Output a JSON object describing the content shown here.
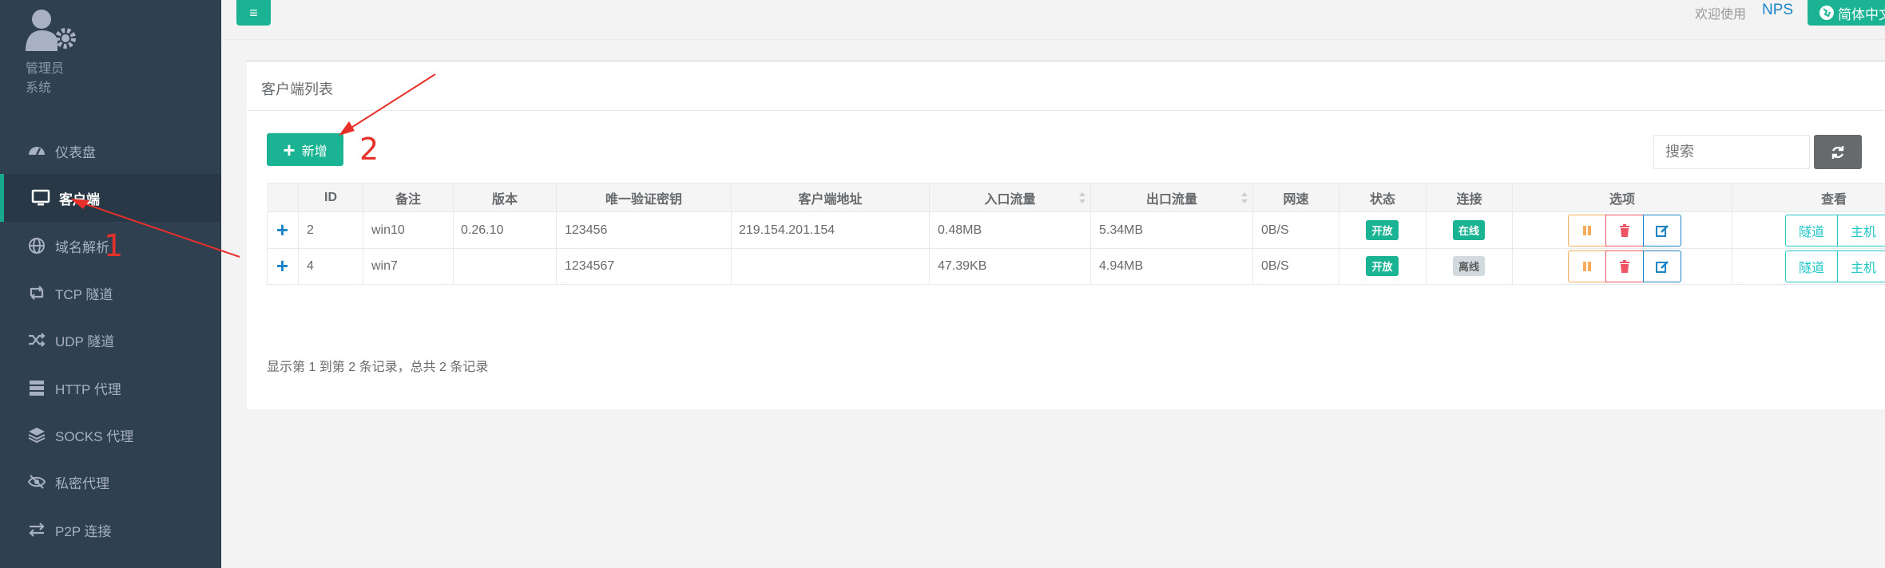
{
  "profile": {
    "name": "管理员",
    "role": "系统"
  },
  "sidebar": {
    "items": [
      {
        "label": "仪表盘",
        "icon": "dashboard-icon"
      },
      {
        "label": "客户端",
        "icon": "monitor-icon"
      },
      {
        "label": "域名解析",
        "icon": "globe-icon"
      },
      {
        "label": "TCP 隧道",
        "icon": "retweet-icon"
      },
      {
        "label": "UDP 隧道",
        "icon": "random-icon"
      },
      {
        "label": "HTTP 代理",
        "icon": "server-icon"
      },
      {
        "label": "SOCKS 代理",
        "icon": "layers-icon"
      },
      {
        "label": "私密代理",
        "icon": "eye-slash-icon"
      },
      {
        "label": "P2P 连接",
        "icon": "exchange-icon"
      }
    ]
  },
  "topbar": {
    "menu_icon": "≡",
    "welcome": "欢迎使用",
    "brand": "NPS",
    "language": "简体中文"
  },
  "panel": {
    "title": "客户端列表",
    "add_label": "新增",
    "search_placeholder": "搜索",
    "footer": "显示第 1 到第 2 条记录，总共 2 条记录"
  },
  "table": {
    "headers": [
      "",
      "ID",
      "备注",
      "版本",
      "唯一验证密钥",
      "客户端地址",
      "入口流量",
      "出口流量",
      "网速",
      "状态",
      "连接",
      "选项",
      "查看"
    ],
    "rows": [
      {
        "id": "2",
        "remark": "win10",
        "version": "0.26.10",
        "vkey": "123456",
        "addr": "219.154.201.154",
        "in_flow": "0.48MB",
        "out_flow": "5.34MB",
        "rate": "0B/S",
        "status": "开放",
        "conn": "在线",
        "conn_online": true
      },
      {
        "id": "4",
        "remark": "win7",
        "version": "",
        "vkey": "1234567",
        "addr": "",
        "in_flow": "47.39KB",
        "out_flow": "4.94MB",
        "rate": "0B/S",
        "status": "开放",
        "conn": "离线",
        "conn_online": false
      }
    ],
    "view_buttons": [
      "隧道",
      "主机"
    ]
  },
  "annotations": {
    "step1": "1",
    "step2": "2"
  },
  "colors": {
    "sidebar_bg": "#2f4050",
    "primary": "#1ab394",
    "warning": "#f8ac59",
    "danger": "#ed5565",
    "info": "#1c84c6",
    "annotation": "#e8302a"
  }
}
